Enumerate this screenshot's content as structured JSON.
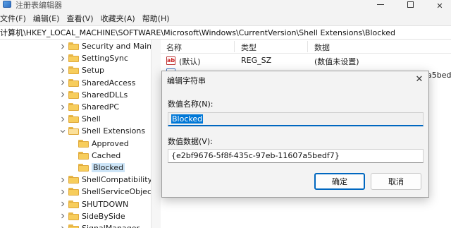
{
  "window": {
    "title": "注册表编辑器"
  },
  "menu": [
    "文件(F)",
    "编辑(E)",
    "查看(V)",
    "收藏夹(A)",
    "帮助(H)"
  ],
  "address": "计算机\\HKEY_LOCAL_MACHINE\\SOFTWARE\\Microsoft\\Windows\\CurrentVersion\\Shell Extensions\\Blocked",
  "tree": {
    "items": [
      {
        "label": "Security and Mainte",
        "expander": ">",
        "folder": "closed"
      },
      {
        "label": "SettingSync",
        "expander": ">",
        "folder": "closed"
      },
      {
        "label": "Setup",
        "expander": ">",
        "folder": "closed"
      },
      {
        "label": "SharedAccess",
        "expander": ">",
        "folder": "closed"
      },
      {
        "label": "SharedDLLs",
        "expander": ">",
        "folder": "closed"
      },
      {
        "label": "SharedPC",
        "expander": ">",
        "folder": "closed"
      },
      {
        "label": "Shell",
        "expander": ">",
        "folder": "closed"
      },
      {
        "label": "Shell Extensions",
        "expander": "v",
        "folder": "open"
      },
      {
        "label": "Approved",
        "expander": "",
        "folder": "closed"
      },
      {
        "label": "Cached",
        "expander": "",
        "folder": "closed"
      },
      {
        "label": "Blocked",
        "expander": "",
        "folder": "closed",
        "selected": true
      },
      {
        "label": "ShellCompatibility",
        "expander": ">",
        "folder": "closed"
      },
      {
        "label": "ShellServiceObjectD",
        "expander": ">",
        "folder": "closed"
      },
      {
        "label": "SHUTDOWN",
        "expander": ">",
        "folder": "closed"
      },
      {
        "label": "SideBySide",
        "expander": ">",
        "folder": "closed"
      },
      {
        "label": "SignalManager",
        "expander": ">",
        "folder": "closed"
      }
    ]
  },
  "list": {
    "columns": [
      "名称",
      "类型",
      "数据"
    ],
    "rows": [
      {
        "name": "(默认)",
        "type": "REG_SZ",
        "data": "(数值未设置)"
      }
    ],
    "partial_value": "a5bed"
  },
  "dialog": {
    "title": "编辑字符串",
    "close_glyph": "✕",
    "name_label": "数值名称(N):",
    "name_value": "Blocked",
    "data_label": "数值数据(V):",
    "data_value": "{e2bf9676-5f8f-435c-97eb-11607a5bedf7}",
    "ok_label": "确定",
    "cancel_label": "取消"
  },
  "colors": {
    "selection": "#0078d7",
    "accent": "#0067c0",
    "folder": "#f7cd5c"
  }
}
